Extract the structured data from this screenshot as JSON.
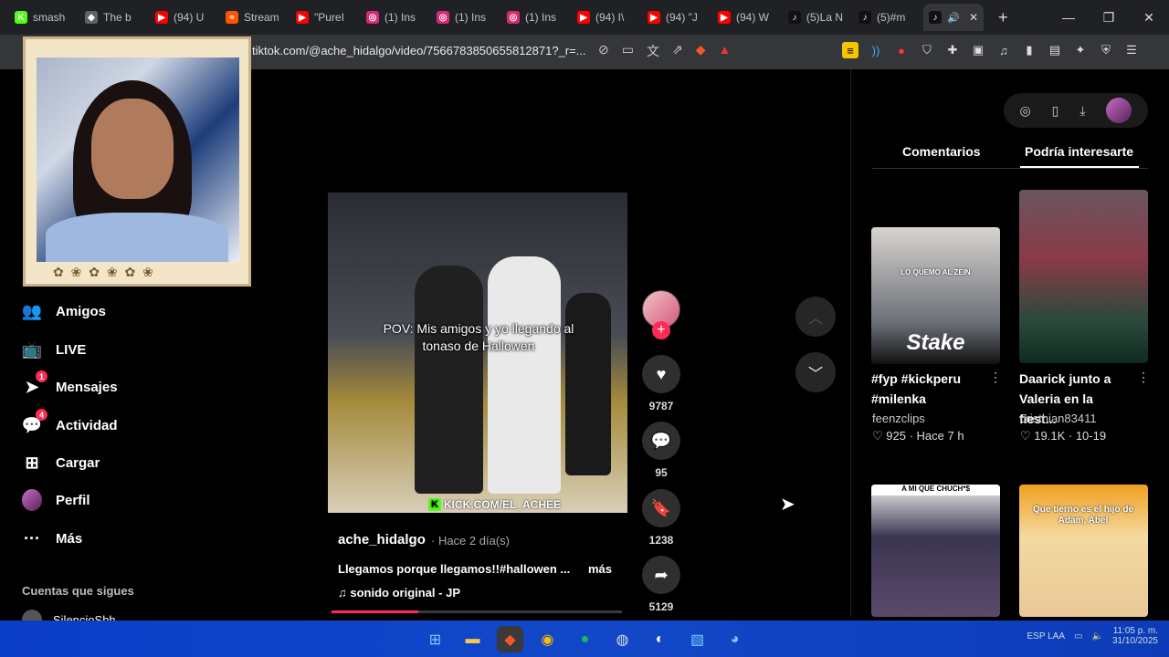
{
  "browser": {
    "tabs": [
      {
        "label": "smash",
        "color": "#53fc18",
        "glyph": "K"
      },
      {
        "label": "The b",
        "color": "#5f6368",
        "glyph": "◆"
      },
      {
        "label": "(94) U",
        "color": "#ff0000",
        "glyph": "▶"
      },
      {
        "label": "Stream",
        "color": "#ff5500",
        "glyph": "≈"
      },
      {
        "label": "\"PureI",
        "color": "#ff0000",
        "glyph": "▶"
      },
      {
        "label": "(1) Ins",
        "color": "#d62976",
        "glyph": "◎"
      },
      {
        "label": "(1) Ins",
        "color": "#d62976",
        "glyph": "◎"
      },
      {
        "label": "(1) Ins",
        "color": "#d62976",
        "glyph": "◎"
      },
      {
        "label": "(94) I\\",
        "color": "#ff0000",
        "glyph": "▶"
      },
      {
        "label": "(94) \"J",
        "color": "#ff0000",
        "glyph": "▶"
      },
      {
        "label": "(94) W",
        "color": "#ff0000",
        "glyph": "▶"
      },
      {
        "label": "(5)La N",
        "color": "#111111",
        "glyph": "♪"
      },
      {
        "label": "(5)#m",
        "color": "#111111",
        "glyph": "♪"
      }
    ],
    "url": "tiktok.com/@ache_hidalgo/video/7566783850655812871?_r=..."
  },
  "nav": {
    "friends": "Amigos",
    "live": "LIVE",
    "messages": "Mensajes",
    "messages_badge": "1",
    "activity": "Actividad",
    "activity_badge": "4",
    "upload": "Cargar",
    "profile": "Perfil",
    "more": "Más",
    "following_title": "Cuentas que sigues",
    "following_user": "SilencioShh"
  },
  "video": {
    "caption": "POV: Mis amigos y yo llegando al tonaso de Hallowen",
    "watermark": "KICK.COM/EL_ACHEE",
    "author": "ache_hidalgo",
    "time": "· Hace 2 día(s)",
    "description": "Llegamos  porque llegamos!!#hallowen ...",
    "more": "más",
    "sound": "sonido original - JP",
    "progress_pct": 30,
    "likes": "9787",
    "comments": "95",
    "saves": "1238",
    "shares": "5129"
  },
  "side": {
    "tab_comments": "Comentarios",
    "tab_suggested": "Podría interesarte",
    "cards": [
      {
        "title": "#fyp #kickperu #milenka",
        "user": "feenzclips",
        "likes": "925",
        "date": "Hace 7 h",
        "thumb_text": "LO QUEMO AL ZEIN",
        "logo": "Stake"
      },
      {
        "title": "Daarick junto a Valeria en la fiest...",
        "user": "cristhian83411",
        "likes": "19.1K",
        "date": "10-19"
      },
      {
        "thumb_text": "A MI QUE CHUCH*$"
      },
      {
        "thumb_text": "Que tierno es el hijo de Adam, Abel"
      }
    ]
  },
  "taskbar": {
    "lang": "ESP LAA",
    "time": "11:05 p. m.",
    "date": "31/10/2025"
  }
}
